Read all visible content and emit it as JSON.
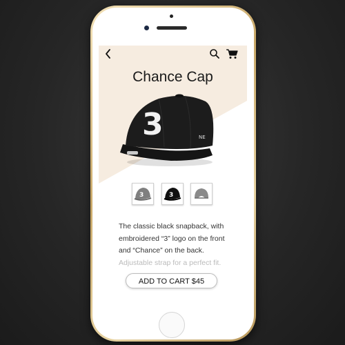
{
  "product": {
    "title": "Chance Cap",
    "description": "The classic black snapback, with embroidered “3” logo on the front and “Chance” on the back.",
    "description_faded": "Adjustable strap for a perfect fit.",
    "cap_logo": "3",
    "brand_mark": "NE"
  },
  "thumbnails": [
    {
      "label": "3",
      "variant": "grey-cap"
    },
    {
      "label": "3",
      "variant": "black-cap"
    },
    {
      "label": "",
      "variant": "cap-back"
    }
  ],
  "actions": {
    "add_to_cart": "ADD TO CART $45"
  },
  "icons": {
    "back": "back-chevron-icon",
    "search": "search-icon",
    "cart": "cart-icon"
  },
  "colors": {
    "accent_background": "#f6ece0",
    "phone_frame": "#d2b575",
    "page_background": "#262626"
  }
}
